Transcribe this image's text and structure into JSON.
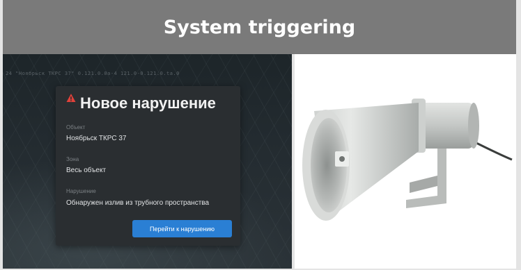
{
  "header": {
    "title": "System triggering"
  },
  "camera_overlay": {
    "text": "24 \"Ноябрьск ТКРС 37\" 0.121.0.0a-4 121.0-0.121.0.ta.0"
  },
  "alert": {
    "icon": "warning-triangle-icon",
    "icon_color": "#e0413a",
    "title": "Новое нарушение",
    "object_label": "Объект",
    "object_value": "Ноябрьск ТКРС 37",
    "zone_label": "Зона",
    "zone_value": "Весь объект",
    "violation_label": "Нарушение",
    "violation_value": "Обнаружен излив из трубного пространства",
    "button_label": "Перейти к нарушению",
    "button_color": "#2a7fd4"
  },
  "product_image": {
    "icon": "horn-speaker-icon"
  }
}
